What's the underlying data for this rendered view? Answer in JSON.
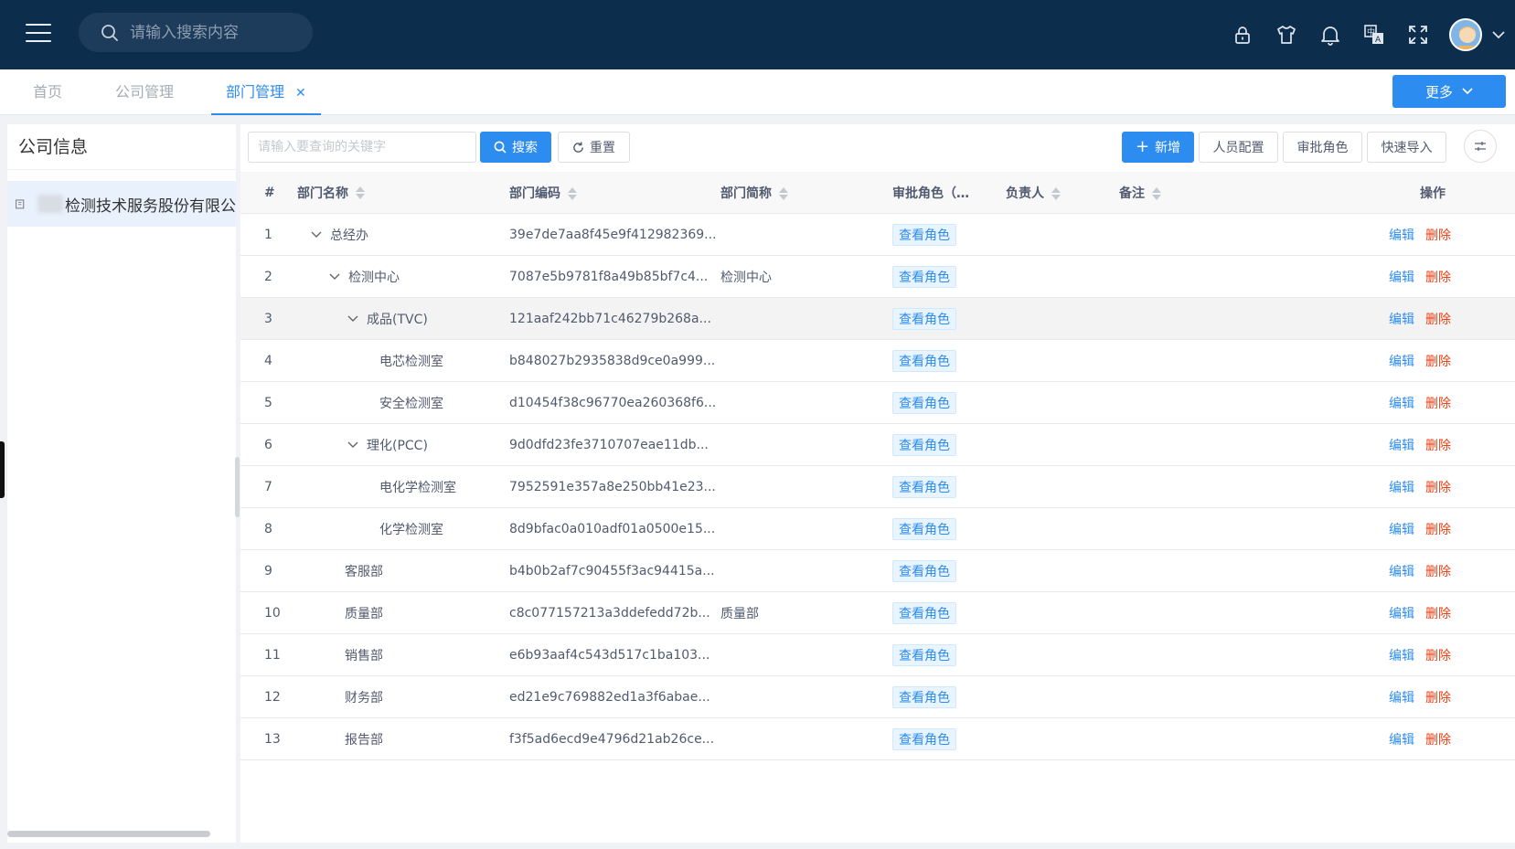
{
  "header": {
    "search_placeholder": "请输入搜索内容",
    "icons": [
      "lock-icon",
      "shirt-icon",
      "bell-icon",
      "translate-icon",
      "fullscreen-icon"
    ],
    "colors": {
      "bg": "#0d2d4c",
      "accent": "#2d8cf0"
    }
  },
  "tabs": [
    {
      "label": "首页"
    },
    {
      "label": "公司管理"
    },
    {
      "label": "部门管理",
      "active": true
    }
  ],
  "more_label": "更多",
  "left": {
    "title": "公司信息",
    "company": "检测技术服务股份有限公"
  },
  "toolbar": {
    "keyword_placeholder": "请输入要查询的关键字",
    "search": "搜索",
    "reset": "重置",
    "add": "新增",
    "staff_config": "人员配置",
    "approval_role": "审批角色",
    "quick_import": "快速导入"
  },
  "table": {
    "headers": {
      "idx": "#",
      "name": "部门名称",
      "code": "部门编码",
      "abbr": "部门简称",
      "role": "审批角色（…",
      "owner": "负责人",
      "remark": "备注",
      "ops": "操作"
    },
    "role_tag": "查看角色",
    "edit": "编辑",
    "delete": "删除",
    "rows": [
      {
        "idx": "1",
        "name": "总经办",
        "code": "39e7de7aa8f45e9f412982369...",
        "abbr": ""
      },
      {
        "idx": "2",
        "name": "检测中心",
        "code": "7087e5b9781f8a49b85bf7c4...",
        "abbr": "检测中心"
      },
      {
        "idx": "3",
        "name": "成品(TVC)",
        "code": "121aaf242bb71c46279b268a...",
        "abbr": ""
      },
      {
        "idx": "4",
        "name": "电芯检测室",
        "code": "b848027b2935838d9ce0a999...",
        "abbr": ""
      },
      {
        "idx": "5",
        "name": "安全检测室",
        "code": "d10454f38c96770ea260368f6...",
        "abbr": ""
      },
      {
        "idx": "6",
        "name": "理化(PCC)",
        "code": "9d0dfd23fe3710707eae11db...",
        "abbr": ""
      },
      {
        "idx": "7",
        "name": "电化学检测室",
        "code": "7952591e357a8e250bb41e23...",
        "abbr": ""
      },
      {
        "idx": "8",
        "name": "化学检测室",
        "code": "8d9bfac0a010adf01a0500e15...",
        "abbr": ""
      },
      {
        "idx": "9",
        "name": "客服部",
        "code": "b4b0b2af7c90455f3ac94415a...",
        "abbr": ""
      },
      {
        "idx": "10",
        "name": "质量部",
        "code": "c8c077157213a3ddefedd72b...",
        "abbr": "质量部"
      },
      {
        "idx": "11",
        "name": "销售部",
        "code": "e6b93aaf4c543d517c1ba103...",
        "abbr": ""
      },
      {
        "idx": "12",
        "name": "财务部",
        "code": "ed21e9c769882ed1a3f6abae...",
        "abbr": ""
      },
      {
        "idx": "13",
        "name": "报告部",
        "code": "f3f5ad6ecd9e4796d21ab26ce...",
        "abbr": ""
      }
    ]
  }
}
